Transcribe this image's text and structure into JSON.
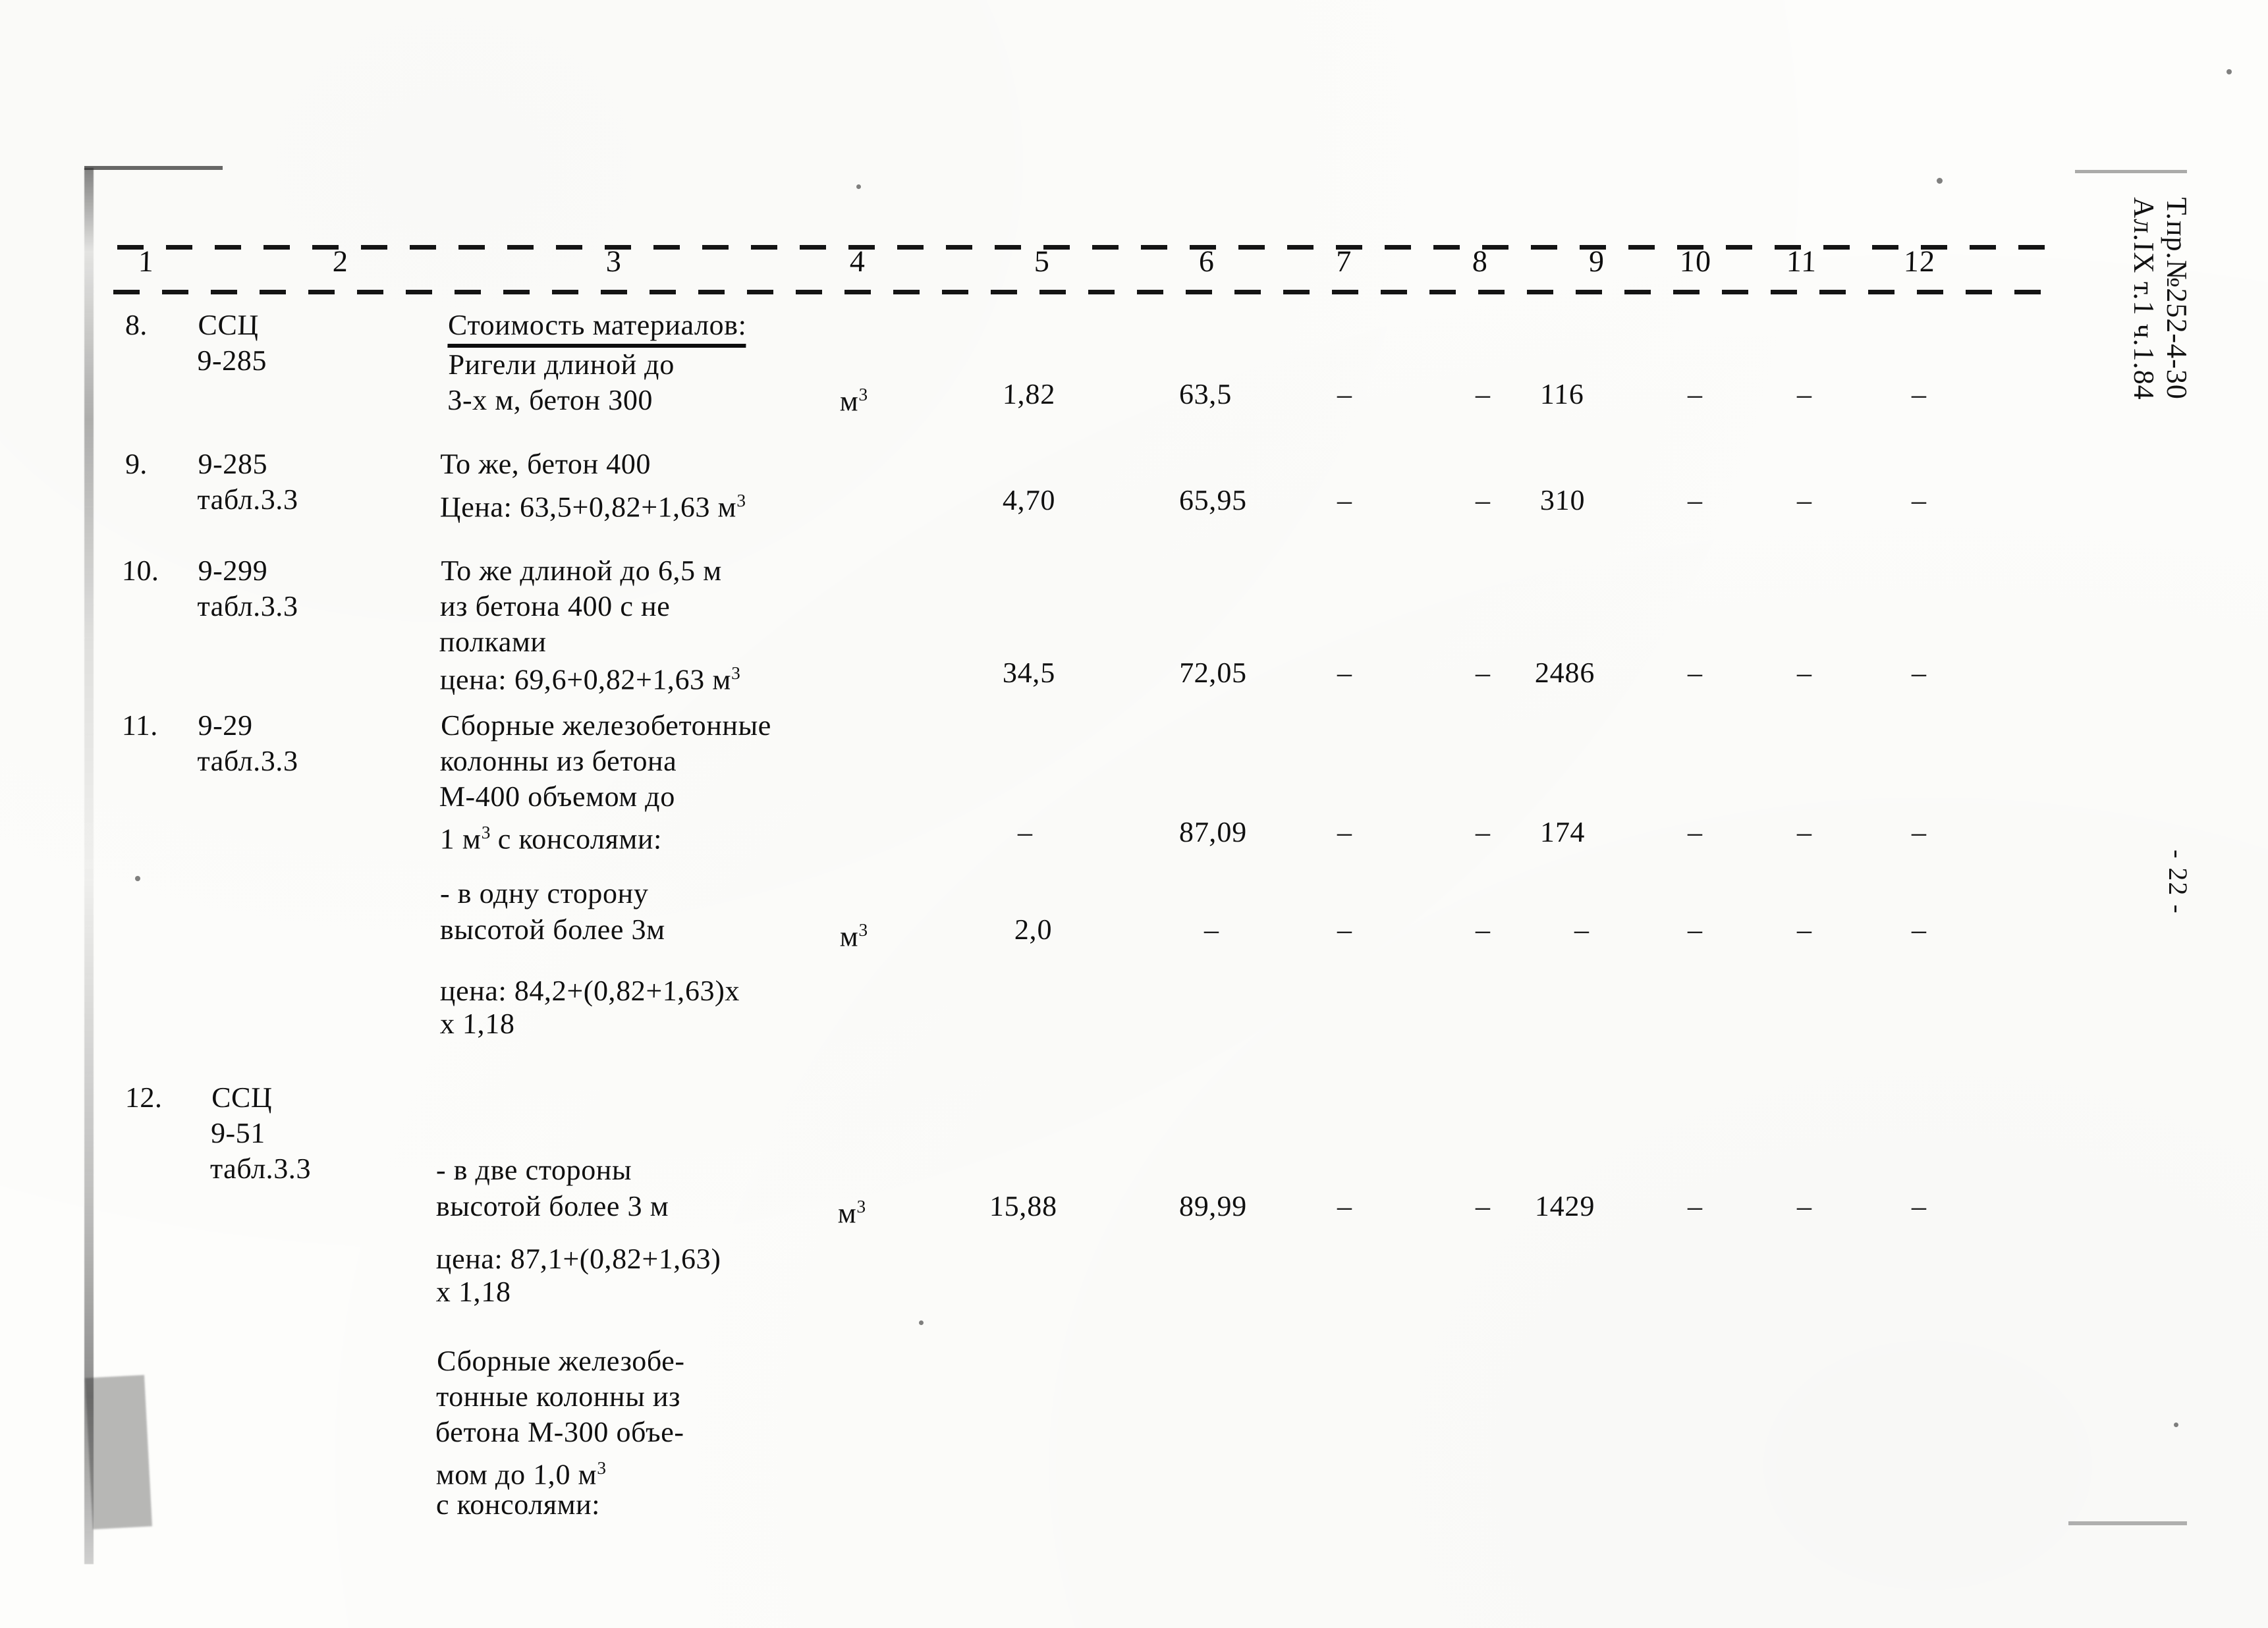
{
  "document": {
    "kind": "scanned-estimate-table",
    "margin_stamp_line1": "Т.пр.№252-4-30",
    "margin_stamp_line2": "Ал.IX т.1 ч.1.84",
    "page_number": "- 22 -"
  },
  "table": {
    "column_headers": [
      "1",
      "2",
      "3",
      "4",
      "5",
      "6",
      "7",
      "8",
      "9",
      "10",
      "11",
      "12"
    ],
    "rows": [
      {
        "num": "8.",
        "code": "ССЦ\n9-285",
        "heading": "Стоимость материалов:",
        "description": "Ригели длиной до\n3-х м, бетон 300",
        "unit": "м",
        "unit_sup": "3",
        "c5": "1,82",
        "c6": "63,5",
        "c7": "–",
        "c8": "–",
        "c9": "116",
        "c10": "–",
        "c11": "–",
        "c12": "–"
      },
      {
        "num": "9.",
        "code": "9-285\nтабл.3.3",
        "description": "То же, бетон 400",
        "price_line": "Цена: 63,5+0,82+1,63 м",
        "price_sup": "3",
        "c5": "4,70",
        "c6": "65,95",
        "c7": "–",
        "c8": "–",
        "c9": "310",
        "c10": "–",
        "c11": "–",
        "c12": "–"
      },
      {
        "num": "10.",
        "code": "9-299\nтабл.3.3",
        "description": "То же длиной до 6,5 м\nиз бетона 400 с не\nполками",
        "price_line": "цена: 69,6+0,82+1,63 м",
        "price_sup": "3",
        "c5": "34,5",
        "c6": "72,05",
        "c7": "–",
        "c8": "–",
        "c9": "2486",
        "c10": "–",
        "c11": "–",
        "c12": "–"
      },
      {
        "num": "11.",
        "code": "9-29\nтабл.3.3",
        "description": "Сборные железобетонные\nколонны из бетона\nМ-400 объемом до",
        "description_last": "1 м",
        "description_last_sup": "3",
        "description_last_tail": " с консолями:",
        "c5": "–",
        "c6": "87,09",
        "c7": "–",
        "c8": "–",
        "c9": "174",
        "c10": "–",
        "c11": "–",
        "c12": "–"
      },
      {
        "sub_description_1": "- в одну сторону",
        "sub_description_2": "высотой более 3м",
        "unit": "м",
        "unit_sup": "3",
        "c5": "2,0",
        "c6": "–",
        "c7": "–",
        "c8": "–",
        "c9": "–",
        "c10": "–",
        "c11": "–",
        "c12": "–"
      },
      {
        "note_1": "цена: 84,2+(0,82+1,63)х",
        "note_2": "х 1,18"
      },
      {
        "num": "12.",
        "code": "ССЦ\n9-51\nтабл.3.3",
        "sub_description_1": "- в две стороны",
        "sub_description_2": "высотой более 3 м",
        "unit": "м",
        "unit_sup": "3",
        "c5": "15,88",
        "c6": "89,99",
        "c7": "–",
        "c8": "–",
        "c9": "1429",
        "c10": "–",
        "c11": "–",
        "c12": "–"
      },
      {
        "note_1": "цена: 87,1+(0,82+1,63)",
        "note_2": "х 1,18"
      },
      {
        "tail_description": "Сборные железобе-\nтонные колонны из\nбетона М-300 объе-",
        "tail_last": "мом до 1,0 м",
        "tail_last_sup": "3",
        "tail_final": "с консолями:"
      }
    ]
  }
}
